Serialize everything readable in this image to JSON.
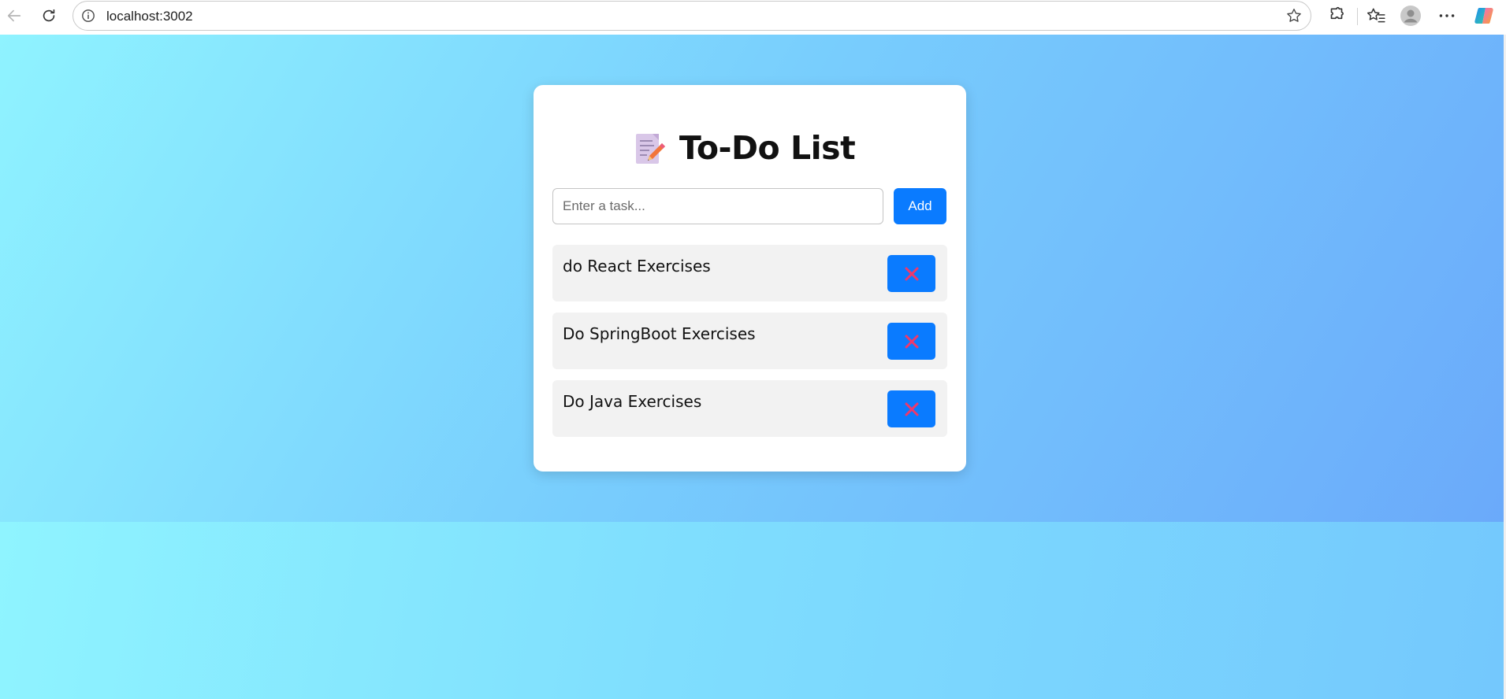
{
  "browser": {
    "url": "localhost:3002",
    "icons": {
      "back": "back-arrow-icon",
      "reload": "reload-icon",
      "site_info": "info-icon",
      "star": "star-icon",
      "extensions": "puzzle-icon",
      "favorites": "favorites-icon",
      "profile": "profile-icon",
      "more": "more-icon",
      "copilot": "copilot-icon"
    }
  },
  "app": {
    "title": "To-Do List",
    "title_icon": "memo-icon",
    "input_placeholder": "Enter a task...",
    "input_value": "",
    "add_label": "Add",
    "delete_icon": "cross-mark-icon",
    "tasks": [
      {
        "text": "do React Exercises"
      },
      {
        "text": "Do SpringBoot Exercises"
      },
      {
        "text": "Do Java Exercises"
      }
    ]
  },
  "colors": {
    "accent": "#0a7bff",
    "delete_glyph": "#f0386b",
    "card_bg": "#ffffff",
    "task_bg": "#f2f2f2",
    "gradient_start": "#8ff3ff",
    "gradient_end": "#69a6fa"
  }
}
